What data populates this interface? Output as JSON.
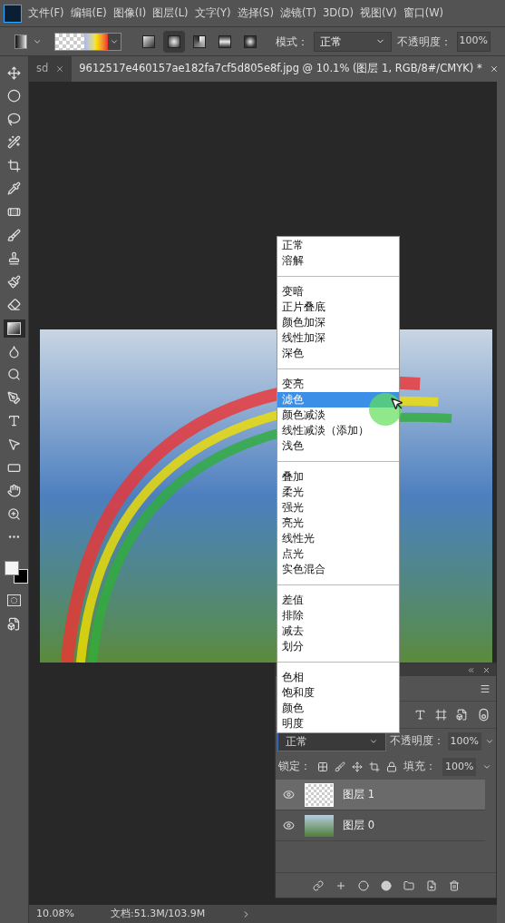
{
  "menu_bar": {
    "items": [
      "文件(F)",
      "编辑(E)",
      "图像(I)",
      "图层(L)",
      "文字(Y)",
      "选择(S)",
      "滤镜(T)",
      "3D(D)",
      "视图(V)",
      "窗口(W)"
    ]
  },
  "options_bar": {
    "gradient_types": [
      {
        "kind": "linear",
        "selected": false
      },
      {
        "kind": "radial",
        "selected": true
      },
      {
        "kind": "angle",
        "selected": false
      },
      {
        "kind": "reflected",
        "selected": false
      },
      {
        "kind": "diamond",
        "selected": false
      }
    ],
    "mode_label": "模式：",
    "mode_value": "正常",
    "opacity_label": "不透明度：",
    "opacity_value": "100%"
  },
  "tabs": [
    {
      "label": "sd",
      "selected": false
    },
    {
      "label": "9612517e460157ae182fa7cf5d805e8f.jpg @ 10.1% (图层 1, RGB/8#/CMYK) *",
      "selected": true
    }
  ],
  "tools": [
    {
      "kind": "move",
      "selected": false
    },
    {
      "kind": "marquee",
      "selected": false
    },
    {
      "kind": "lasso",
      "selected": false
    },
    {
      "kind": "quick-select",
      "selected": false
    },
    {
      "kind": "crop",
      "selected": false
    },
    {
      "kind": "eyedropper",
      "selected": false
    },
    {
      "kind": "healing",
      "selected": false
    },
    {
      "kind": "brush",
      "selected": false
    },
    {
      "kind": "stamp",
      "selected": false
    },
    {
      "kind": "history-brush",
      "selected": false
    },
    {
      "kind": "eraser",
      "selected": false
    },
    {
      "kind": "gradient",
      "selected": true
    },
    {
      "kind": "blur",
      "selected": false
    },
    {
      "kind": "dodge",
      "selected": false
    },
    {
      "kind": "pen",
      "selected": false
    },
    {
      "kind": "type",
      "selected": false
    },
    {
      "kind": "path-select",
      "selected": false
    },
    {
      "kind": "shape",
      "selected": false
    },
    {
      "kind": "hand",
      "selected": false
    },
    {
      "kind": "zoom",
      "selected": false
    },
    {
      "kind": "more",
      "selected": false
    }
  ],
  "blend_menu": {
    "groups": [
      [
        {
          "label": "正常",
          "selected": false
        },
        {
          "label": "溶解",
          "selected": false
        }
      ],
      [
        {
          "label": "变暗",
          "selected": false
        },
        {
          "label": "正片叠底",
          "selected": false
        },
        {
          "label": "颜色加深",
          "selected": false
        },
        {
          "label": "线性加深",
          "selected": false
        },
        {
          "label": "深色",
          "selected": false
        }
      ],
      [
        {
          "label": "变亮",
          "selected": false
        },
        {
          "label": "滤色",
          "selected": true
        },
        {
          "label": "颜色减淡",
          "selected": false
        },
        {
          "label": "线性减淡（添加）",
          "selected": false
        },
        {
          "label": "浅色",
          "selected": false
        }
      ],
      [
        {
          "label": "叠加",
          "selected": false
        },
        {
          "label": "柔光",
          "selected": false
        },
        {
          "label": "强光",
          "selected": false
        },
        {
          "label": "亮光",
          "selected": false
        },
        {
          "label": "线性光",
          "selected": false
        },
        {
          "label": "点光",
          "selected": false
        },
        {
          "label": "实色混合",
          "selected": false
        }
      ],
      [
        {
          "label": "差值",
          "selected": false
        },
        {
          "label": "排除",
          "selected": false
        },
        {
          "label": "减去",
          "selected": false
        },
        {
          "label": "划分",
          "selected": false
        }
      ],
      [
        {
          "label": "色相",
          "selected": false
        },
        {
          "label": "饱和度",
          "selected": false
        },
        {
          "label": "颜色",
          "selected": false
        },
        {
          "label": "明度",
          "selected": false
        }
      ]
    ]
  },
  "layers_panel": {
    "blend_mode": "正常",
    "opacity_label": "不透明度：",
    "opacity_value": "100%",
    "lock_label": "锁定：",
    "fill_label": "填充：",
    "fill_value": "100%",
    "layers": [
      {
        "name": "图层 1",
        "selected": true,
        "visible": true,
        "kind": "transparent"
      },
      {
        "name": "图层 0",
        "selected": false,
        "visible": true,
        "kind": "photo"
      }
    ]
  },
  "status_bar": {
    "zoom": "10.08%",
    "document": "文档:51.3M/103.9M"
  }
}
